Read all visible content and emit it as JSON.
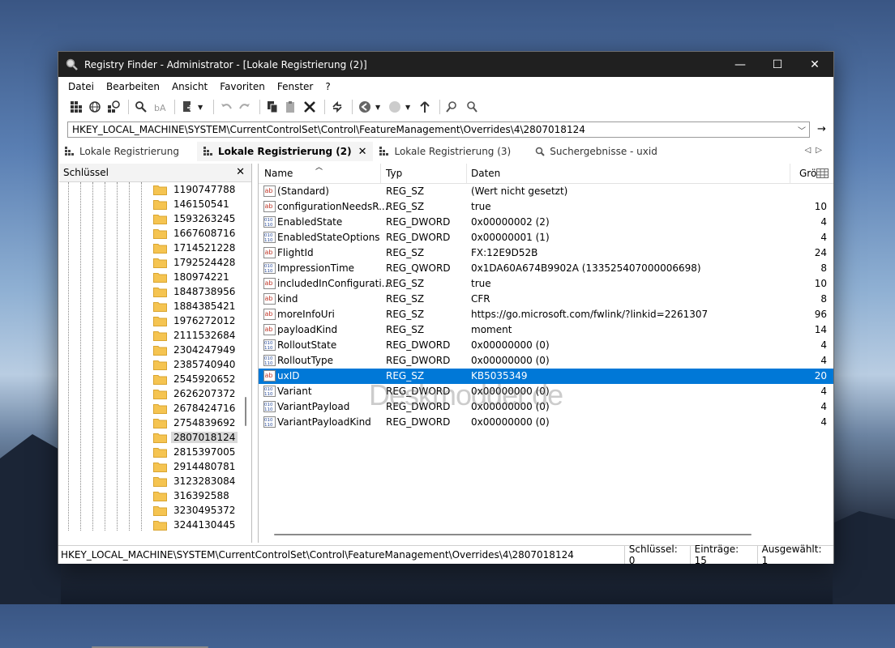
{
  "window": {
    "title": "Registry Finder - Administrator - [Lokale Registrierung (2)]",
    "controls": {
      "minimize": "—",
      "maximize": "☐",
      "close": "✕"
    }
  },
  "menu": [
    "Datei",
    "Bearbeiten",
    "Ansicht",
    "Favoriten",
    "Fenster",
    "?"
  ],
  "address": {
    "value": "HKEY_LOCAL_MACHINE\\SYSTEM\\CurrentControlSet\\Control\\FeatureManagement\\Overrides\\4\\2807018124"
  },
  "tabs": [
    {
      "label": "Lokale Registrierung",
      "active": false
    },
    {
      "label": "Lokale Registrierung (2)",
      "active": true
    },
    {
      "label": "Lokale Registrierung (3)",
      "active": false
    },
    {
      "label": "Suchergebnisse - uxid",
      "active": false
    }
  ],
  "left_pane": {
    "title": "Schlüssel",
    "keys": [
      "1190747788",
      "146150541",
      "1593263245",
      "1667608716",
      "1714521228",
      "1792524428",
      "180974221",
      "1848738956",
      "1884385421",
      "1976272012",
      "2111532684",
      "2304247949",
      "2385740940",
      "2545920652",
      "2626207372",
      "2678424716",
      "2754839692",
      "2807018124",
      "2815397005",
      "2914480781",
      "3123283084",
      "316392588",
      "3230495372",
      "3244130445"
    ],
    "selected": "2807018124"
  },
  "columns": {
    "name": "Name",
    "type": "Typ",
    "data": "Daten",
    "size": "Grö"
  },
  "values": [
    {
      "name": "(Standard)",
      "type": "REG_SZ",
      "data": "(Wert nicht gesetzt)",
      "size": "",
      "icon": "string-value-icon"
    },
    {
      "name": "configurationNeedsR...",
      "type": "REG_SZ",
      "data": "true",
      "size": "10",
      "icon": "string-value-icon"
    },
    {
      "name": "EnabledState",
      "type": "REG_DWORD",
      "data": "0x00000002 (2)",
      "size": "4",
      "icon": "binary-value-icon"
    },
    {
      "name": "EnabledStateOptions",
      "type": "REG_DWORD",
      "data": "0x00000001 (1)",
      "size": "4",
      "icon": "binary-value-icon"
    },
    {
      "name": "FlightId",
      "type": "REG_SZ",
      "data": "FX:12E9D52B",
      "size": "24",
      "icon": "string-value-icon"
    },
    {
      "name": "ImpressionTime",
      "type": "REG_QWORD",
      "data": "0x1DA60A674B9902A (133525407000006698)",
      "size": "8",
      "icon": "binary-value-icon"
    },
    {
      "name": "includedInConfigurati...",
      "type": "REG_SZ",
      "data": "true",
      "size": "10",
      "icon": "string-value-icon"
    },
    {
      "name": "kind",
      "type": "REG_SZ",
      "data": "CFR",
      "size": "8",
      "icon": "string-value-icon"
    },
    {
      "name": "moreInfoUri",
      "type": "REG_SZ",
      "data": "https://go.microsoft.com/fwlink/?linkid=2261307",
      "size": "96",
      "icon": "string-value-icon"
    },
    {
      "name": "payloadKind",
      "type": "REG_SZ",
      "data": "moment",
      "size": "14",
      "icon": "string-value-icon"
    },
    {
      "name": "RolloutState",
      "type": "REG_DWORD",
      "data": "0x00000000 (0)",
      "size": "4",
      "icon": "binary-value-icon"
    },
    {
      "name": "RolloutType",
      "type": "REG_DWORD",
      "data": "0x00000000 (0)",
      "size": "4",
      "icon": "binary-value-icon"
    },
    {
      "name": "uxID",
      "type": "REG_SZ",
      "data": "KB5035349",
      "size": "20",
      "icon": "string-value-icon",
      "selected": true
    },
    {
      "name": "Variant",
      "type": "REG_DWORD",
      "data": "0x00000000 (0)",
      "size": "4",
      "icon": "binary-value-icon"
    },
    {
      "name": "VariantPayload",
      "type": "REG_DWORD",
      "data": "0x00000000 (0)",
      "size": "4",
      "icon": "binary-value-icon"
    },
    {
      "name": "VariantPayloadKind",
      "type": "REG_DWORD",
      "data": "0x00000000 (0)",
      "size": "4",
      "icon": "binary-value-icon"
    }
  ],
  "status": {
    "path": "HKEY_LOCAL_MACHINE\\SYSTEM\\CurrentControlSet\\Control\\FeatureManagement\\Overrides\\4\\2807018124",
    "keys": "Schlüssel: 0",
    "entries": "Einträge: 15",
    "selected": "Ausgewählt: 1"
  },
  "watermark": "Deskmodder.de",
  "colors": {
    "titlebar": "#202020",
    "selection": "#0078d7",
    "folder": "#f5c451"
  }
}
